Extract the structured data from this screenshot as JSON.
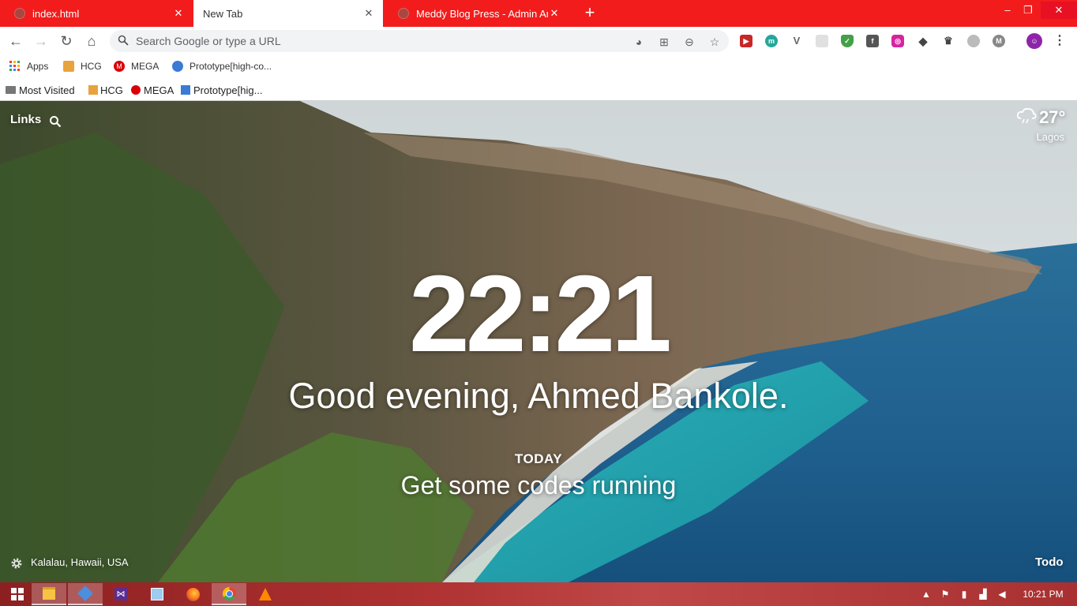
{
  "tabs": [
    {
      "title": "index.html",
      "active": false
    },
    {
      "title": "New Tab",
      "active": true
    },
    {
      "title": "Meddy Blog Press - Admin Area",
      "active": false
    }
  ],
  "window_controls": {
    "minimize": "–",
    "maximize": "❐",
    "close": "✕"
  },
  "toolbar": {
    "omnibox_placeholder": "Search Google or type a URL",
    "extension_icons": [
      "ext-red-icon",
      "ext-m-teal-icon",
      "ext-v-icon",
      "ext-grid-icon",
      "ext-shield-icon",
      "facebook-icon",
      "instagram-icon",
      "ext-layers-icon",
      "ext-crown-icon",
      "ext-circle-icon",
      "ext-m-gray-icon",
      "profile-avatar-icon",
      "menu-dots-icon"
    ]
  },
  "bookmarks_bar": {
    "items": [
      {
        "label": "Apps",
        "icon": "apps-grid-icon"
      },
      {
        "label": "HCG",
        "icon": "hcg-icon"
      },
      {
        "label": "MEGA",
        "icon": "mega-icon"
      },
      {
        "label": "Prototype[high-co...",
        "icon": "prototype-icon"
      }
    ]
  },
  "bookmarks_bar_2": {
    "items": [
      {
        "label": "Most Visited",
        "icon": "folder-icon"
      },
      {
        "label": "HCG",
        "icon": "hcg-icon"
      },
      {
        "label": "MEGA",
        "icon": "mega-icon"
      },
      {
        "label": "Prototype[hig...",
        "icon": "prototype-icon"
      }
    ]
  },
  "newtab": {
    "links_label": "Links",
    "time": "22:21",
    "greeting": "Good evening, Ahmed Bankole.",
    "today_label": "TODAY",
    "focus": "Get some codes running",
    "weather_temp": "27°",
    "weather_city": "Lagos",
    "photo_location": "Kalalau, Hawaii, USA",
    "todo_label": "Todo"
  },
  "taskbar": {
    "apps": [
      "windows-start-icon",
      "file-explorer-icon",
      "sourcetree-icon",
      "visual-studio-icon",
      "cube-app-icon",
      "firefox-icon",
      "chrome-icon",
      "vlc-icon"
    ],
    "time": "10:21 PM"
  },
  "colors": {
    "tab_strip": "#f21c1c",
    "taskbar": "#b03232",
    "accent_close": "#e81123"
  }
}
